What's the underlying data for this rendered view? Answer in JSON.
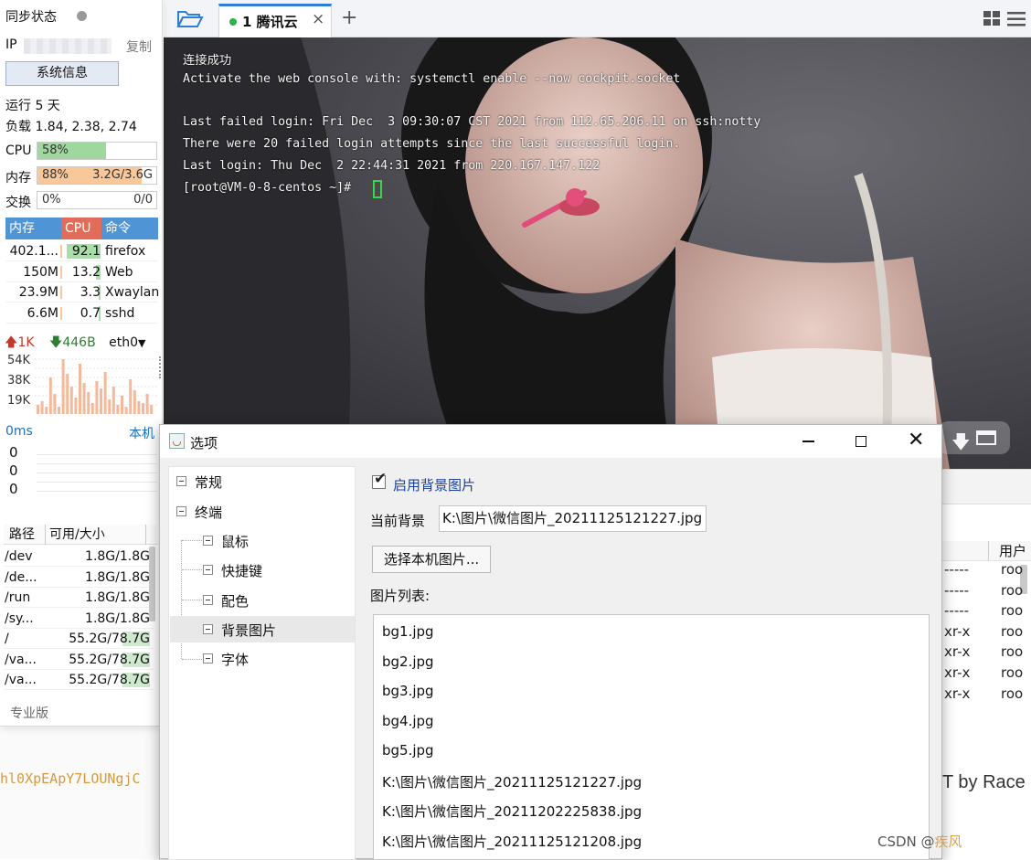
{
  "sidebar": {
    "sync_label": "同步状态",
    "ip_label": "IP",
    "copy_label": "复制",
    "sysinfo_button": "系统信息",
    "uptime": "运行 5 天",
    "load": "负载 1.84, 2.38, 2.74",
    "cpu": {
      "label": "CPU",
      "value": "58%",
      "fraction": 0.58,
      "color": "#9fd79f"
    },
    "mem": {
      "label": "内存",
      "value": "88%",
      "detail": "3.2G/3.6G",
      "fraction": 0.88,
      "color": "#f8c79a"
    },
    "swap": {
      "label": "交换",
      "value": "0%",
      "detail": "0/0",
      "fraction": 0.0
    },
    "process_headers": [
      "内存",
      "CPU",
      "命令"
    ],
    "processes": [
      {
        "mem": "402.1...",
        "cpu": "92.1",
        "cmd": "firefox",
        "cpu_fraction": 0.92
      },
      {
        "mem": "150M",
        "cpu": "13.2",
        "cmd": "Web",
        "cpu_fraction": 0.13
      },
      {
        "mem": "23.9M",
        "cpu": "3.3",
        "cmd": "Xwaylan",
        "cpu_fraction": 0.03
      },
      {
        "mem": "6.6M",
        "cpu": "0.7",
        "cmd": "sshd",
        "cpu_fraction": 0.01
      }
    ],
    "net": {
      "up": "1K",
      "down": "446B",
      "iface": "eth0",
      "ticks": [
        "54K",
        "38K",
        "19K"
      ]
    },
    "ping": {
      "latency": "0ms",
      "host": "本机",
      "values": [
        "0",
        "0",
        "0"
      ]
    },
    "disk_headers": [
      "路径",
      "可用/大小"
    ],
    "disks": [
      {
        "path": "/dev",
        "size": "1.8G/1.8G",
        "used_fraction": 0.0
      },
      {
        "path": "/de...",
        "size": "1.8G/1.8G",
        "used_fraction": 0.0
      },
      {
        "path": "/run",
        "size": "1.8G/1.8G",
        "used_fraction": 0.01
      },
      {
        "path": "/sy...",
        "size": "1.8G/1.8G",
        "used_fraction": 0.0
      },
      {
        "path": "/",
        "size": "55.2G/78.7G",
        "used_fraction": 0.3
      },
      {
        "path": "/va...",
        "size": "55.2G/78.7G",
        "used_fraction": 0.3
      },
      {
        "path": "/va...",
        "size": "55.2G/78.7G",
        "used_fraction": 0.3
      }
    ],
    "edition": "专业版"
  },
  "tabs": {
    "active_label": "1 腾讯云",
    "close": "×",
    "add": "+"
  },
  "terminal": {
    "lines": [
      "连接成功",
      "Activate the web console with: systemctl enable --now cockpit.socket",
      "",
      "Last failed login: Fri Dec  3 09:30:07 CST 2021 from 112.65.206.11 on ssh:notty",
      "There were 20 failed login attempts since the last successful login.",
      "Last login: Thu Dec  2 22:44:31 2021 from 220.167.147.122",
      "[root@VM-0-8-centos ~]# "
    ]
  },
  "dialog": {
    "title": "选项",
    "tree": [
      "常规",
      "终端",
      "鼠标",
      "快捷键",
      "配色",
      "背景图片",
      "字体"
    ],
    "enable_bg_label": "启用背景图片",
    "enable_bg_checked": true,
    "current_bg_label": "当前背景",
    "current_bg_value": "K:\\图片\\微信图片_20211125121227.jpg",
    "choose_button": "选择本机图片...",
    "list_label": "图片列表:",
    "images": [
      "bg1.jpg",
      "bg2.jpg",
      "bg3.jpg",
      "bg4.jpg",
      "bg5.jpg",
      "K:\\图片\\微信图片_20211125121227.jpg",
      "K:\\图片\\微信图片_20211202225838.jpg",
      "K:\\图片\\微信图片_20211125121208.jpg"
    ]
  },
  "background": {
    "code_text": "hl0XpEApY7LOUNgjC",
    "right_text": "T by Race",
    "perm_header": "用户",
    "perms": [
      "-----",
      "-----",
      "-----",
      "xr-x",
      "xr-x",
      "xr-x",
      "xr-x"
    ],
    "owners": [
      "roo",
      "roo",
      "roo",
      "roo",
      "roo",
      "roo",
      "roo"
    ],
    "watermark": "CSDN @"
  }
}
